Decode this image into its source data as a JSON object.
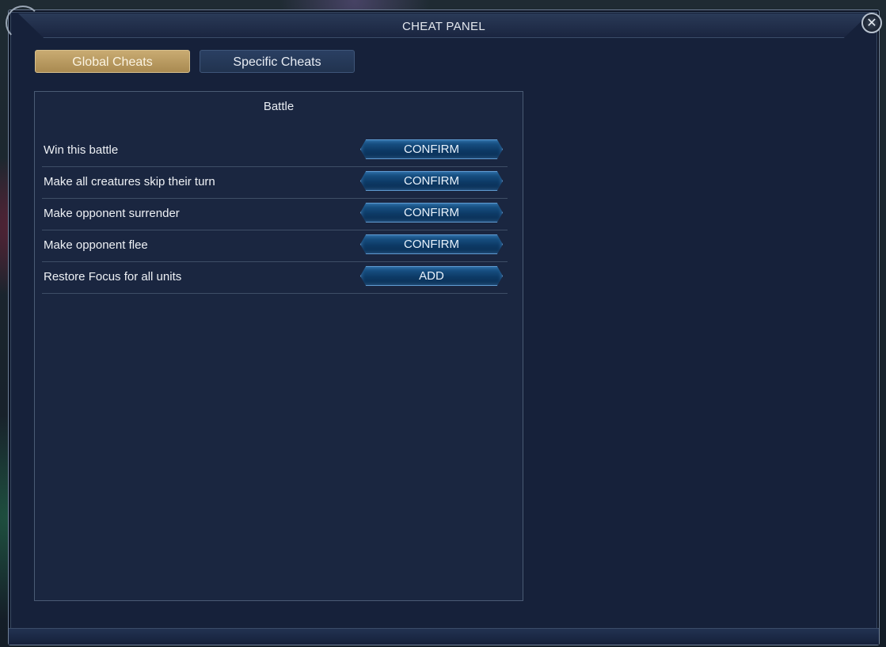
{
  "panel": {
    "title": "CHEAT PANEL",
    "close_symbol": "✕"
  },
  "tabs": [
    {
      "label": "Global Cheats",
      "active": true
    },
    {
      "label": "Specific Cheats",
      "active": false
    }
  ],
  "section": {
    "title": "Battle",
    "rows": [
      {
        "label": "Win this battle",
        "button": "CONFIRM"
      },
      {
        "label": "Make all creatures skip their turn",
        "button": "CONFIRM"
      },
      {
        "label": "Make opponent surrender",
        "button": "CONFIRM"
      },
      {
        "label": "Make opponent flee",
        "button": "CONFIRM"
      },
      {
        "label": "Restore Focus for all units",
        "button": "ADD"
      }
    ]
  },
  "colors": {
    "active_tab": "#c9ab72",
    "inactive_tab": "#2a3f62",
    "panel_bg": "#16213a",
    "button_bg": "#0d3a66"
  },
  "icons": {
    "close": "close-icon"
  }
}
